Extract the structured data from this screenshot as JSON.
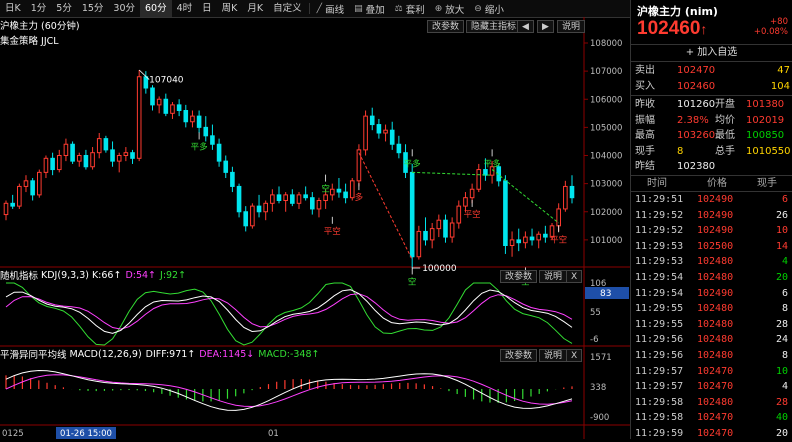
{
  "toolbar": {
    "periods": [
      "日K",
      "1分",
      "5分",
      "15分",
      "30分",
      "60分",
      "4时",
      "日",
      "周K",
      "月K",
      "自定义"
    ],
    "active_period": "60分",
    "tools": [
      {
        "icon": "line-tool-icon",
        "label": "画线"
      },
      {
        "icon": "overlay-icon",
        "label": "叠加"
      },
      {
        "icon": "arbitrage-icon",
        "label": "套利"
      },
      {
        "icon": "zoom-in-icon",
        "label": "放大"
      },
      {
        "icon": "zoom-out-icon",
        "label": "缩小"
      }
    ]
  },
  "main_panel": {
    "title": "沪橡主力 (60分钟)",
    "strategy": "集金策略 JJCL",
    "btn_params": "改参数",
    "btn_hide": "隐藏主指标",
    "btn_help": "说明",
    "high_label": "107040",
    "low_label": "100000",
    "y_ticks": [
      "108000",
      "107000",
      "106000",
      "105000",
      "104000",
      "103000",
      "102000",
      "101000"
    ],
    "signals": [
      "平多",
      "平空",
      "平多",
      "平空",
      "平空",
      "平多",
      "空",
      "多",
      "空",
      "空"
    ]
  },
  "kdj_panel": {
    "name": "随机指标",
    "params": "KDJ(9,3,3)",
    "k_label": "K:66↑",
    "d_label": "D:54↑",
    "j_label": "J:92↑",
    "btn_params": "改参数",
    "btn_help": "说明",
    "btn_close": "X",
    "current_tag": "83",
    "y_ticks": [
      "106",
      "55",
      "-6"
    ]
  },
  "macd_panel": {
    "name": "平滑异同平均线",
    "params": "MACD(12,26,9)",
    "diff_label": "DIFF:971↑",
    "dea_label": "DEA:1145↓",
    "macd_label": "MACD:-348↑",
    "btn_params": "改参数",
    "btn_help": "说明",
    "btn_close": "X",
    "y_ticks": [
      "1571",
      "338",
      "-900"
    ]
  },
  "time_axis": {
    "left_label": "0125",
    "cursor_label": "01-26 15:00",
    "mid_label": "01"
  },
  "quote": {
    "title": "沪橡主力 (nim)",
    "price": "102460",
    "change": "+80",
    "change_pct": "+0.08%",
    "add_favorite": "+ 加入自选",
    "sell_label": "卖出",
    "sell_price": "102470",
    "sell_vol": "47",
    "buy_label": "买入",
    "buy_price": "102460",
    "buy_vol": "104",
    "rows": [
      {
        "l1": "昨收",
        "v1": "101260",
        "l2": "开盘",
        "v2": "101380"
      },
      {
        "l1": "振幅",
        "v1": "2.38%",
        "l2": "均价",
        "v2": "102019"
      },
      {
        "l1": "最高",
        "v1": "103260",
        "l2": "最低",
        "v2": "100850"
      },
      {
        "l1": "现手",
        "v1": "8",
        "l2": "总手",
        "v2": "1010550"
      },
      {
        "l1": "昨结",
        "v1": "102380",
        "l2": "",
        "v2": ""
      }
    ]
  },
  "ticks": {
    "headers": [
      "时间",
      "价格",
      "现手"
    ],
    "rows": [
      {
        "t": "11:29:51",
        "p": "102490",
        "v": "6",
        "c": "red"
      },
      {
        "t": "11:29:52",
        "p": "102490",
        "v": "26",
        "c": "white"
      },
      {
        "t": "11:29:52",
        "p": "102490",
        "v": "10",
        "c": "red"
      },
      {
        "t": "11:29:53",
        "p": "102500",
        "v": "14",
        "c": "red"
      },
      {
        "t": "11:29:53",
        "p": "102480",
        "v": "4",
        "c": "green"
      },
      {
        "t": "11:29:54",
        "p": "102480",
        "v": "20",
        "c": "green"
      },
      {
        "t": "11:29:54",
        "p": "102490",
        "v": "6",
        "c": "white"
      },
      {
        "t": "11:29:55",
        "p": "102480",
        "v": "8",
        "c": "white"
      },
      {
        "t": "11:29:55",
        "p": "102480",
        "v": "28",
        "c": "white"
      },
      {
        "t": "11:29:56",
        "p": "102480",
        "v": "24",
        "c": "white"
      },
      {
        "t": "11:29:56",
        "p": "102480",
        "v": "8",
        "c": "white"
      },
      {
        "t": "11:29:57",
        "p": "102470",
        "v": "10",
        "c": "green"
      },
      {
        "t": "11:29:57",
        "p": "102470",
        "v": "4",
        "c": "white"
      },
      {
        "t": "11:29:58",
        "p": "102480",
        "v": "28",
        "c": "red"
      },
      {
        "t": "11:29:58",
        "p": "102470",
        "v": "40",
        "c": "green"
      },
      {
        "t": "11:29:59",
        "p": "102470",
        "v": "20",
        "c": "white"
      }
    ]
  },
  "colors": {
    "up": "#ff3b30",
    "down": "#00e5ee",
    "k": "#ffffff",
    "d": "#ff40ff",
    "j": "#33dd33",
    "diff": "#ffffff",
    "dea": "#ff40ff"
  }
}
